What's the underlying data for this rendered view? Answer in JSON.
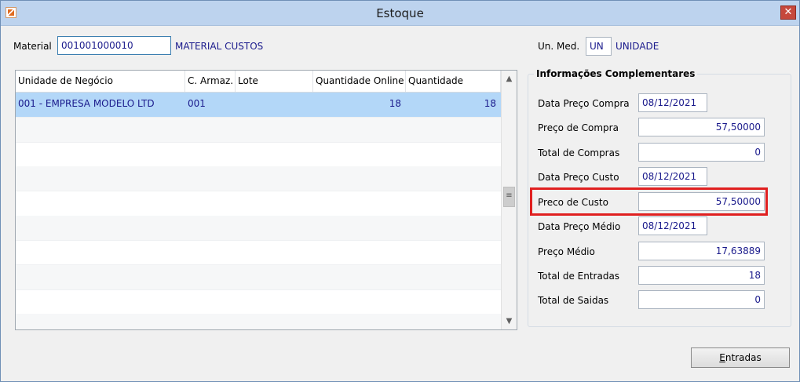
{
  "window": {
    "title": "Estoque",
    "close_glyph": "✕"
  },
  "material": {
    "label": "Material",
    "code": "001001000010",
    "description": "MATERIAL CUSTOS"
  },
  "unit": {
    "label": "Un. Med.",
    "code": "UN",
    "description": "UNIDADE"
  },
  "grid": {
    "columns": [
      "Unidade de Negócio",
      "C. Armaz.",
      "Lote",
      "Quantidade Online",
      "Quantidade"
    ],
    "rows": [
      [
        "001 - EMPRESA MODELO LTD",
        "001",
        "",
        "18",
        "18"
      ]
    ]
  },
  "info": {
    "title": "Informações Complementares",
    "fields": [
      {
        "label": "Data Preço Compra",
        "value": "08/12/2021"
      },
      {
        "label": "Preço de Compra",
        "value": "57,50000"
      },
      {
        "label": "Total de Compras",
        "value": "0"
      },
      {
        "label": "Data Preço Custo",
        "value": "08/12/2021"
      },
      {
        "label": "Preco de Custo",
        "value": "57,50000"
      },
      {
        "label": "Data Preço Médio",
        "value": "08/12/2021"
      },
      {
        "label": "Preço Médio",
        "value": "17,63889"
      },
      {
        "label": "Total de Entradas",
        "value": "18"
      },
      {
        "label": "Total de Saidas",
        "value": "0"
      }
    ]
  },
  "buttons": {
    "entradas_first": "E",
    "entradas_rest": "ntradas"
  },
  "colors": {
    "highlight": "#e02020",
    "selection": "#b3d7f8",
    "value_text": "#1a1a8c"
  }
}
